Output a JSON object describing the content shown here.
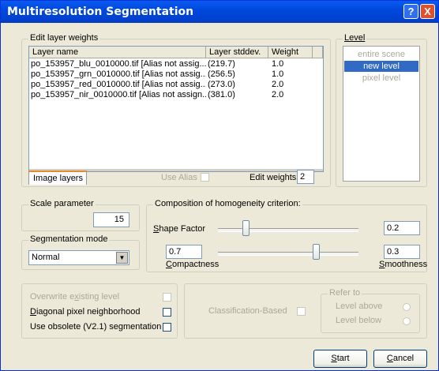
{
  "window": {
    "title": "Multiresolution Segmentation",
    "help_symbol": "?",
    "close_symbol": "X"
  },
  "layer_weights": {
    "legend": "Edit layer weights",
    "columns": [
      "Layer name",
      "Layer stddev.",
      "Weight"
    ],
    "rows": [
      {
        "name": "po_153957_blu_0010000.tif [Alias not assig...",
        "stddev": "(219.7)",
        "weight": "1.0"
      },
      {
        "name": "po_153957_grn_0010000.tif [Alias not assig...",
        "stddev": "(256.5)",
        "weight": "1.0"
      },
      {
        "name": "po_153957_red_0010000.tif [Alias not assig...",
        "stddev": "(273.0)",
        "weight": "2.0"
      },
      {
        "name": "po_153957_nir_0010000.tif [Alias not assign...",
        "stddev": "(381.0)",
        "weight": "2.0"
      }
    ],
    "tab_label": "Image layers",
    "use_alias_label": "Use Alias",
    "edit_weights_label": "Edit weights:",
    "edit_weights_value": "2"
  },
  "level": {
    "legend": "Level",
    "items": [
      "entire scene",
      "new level",
      "pixel level"
    ],
    "selected": "new level"
  },
  "scale": {
    "legend": "Scale parameter",
    "value": "15"
  },
  "seg_mode": {
    "legend": "Segmentation mode",
    "value": "Normal"
  },
  "homogeneity": {
    "legend": "Composition of homogeneity criterion:",
    "shape_label_pre": "S",
    "shape_label_rest": "hape Factor",
    "shape_value": "0.2",
    "shape_fraction": 0.2,
    "compactness_value": "0.7",
    "compactness_label_pre": "C",
    "compactness_label_rest": "ompactness",
    "compact_fraction": 0.7,
    "smoothness_value": "0.3",
    "smoothness_label_pre": "S",
    "smoothness_label_rest": "moothness"
  },
  "options": {
    "overwrite_pre": "Overwrite e",
    "overwrite_u": "x",
    "overwrite_post": "isting level",
    "diagonal_u": "D",
    "diagonal_rest": "iagonal pixel neighborhood",
    "obsolete_label": "Use obsolete (V2.1) segmentation"
  },
  "classification": {
    "label": "Classification-Based",
    "refer_legend": "Refer to",
    "level_above": "Level above",
    "level_below": "Level below"
  },
  "buttons": {
    "start_u": "S",
    "start_rest": "tart",
    "cancel_u": "C",
    "cancel_rest": "ancel"
  }
}
